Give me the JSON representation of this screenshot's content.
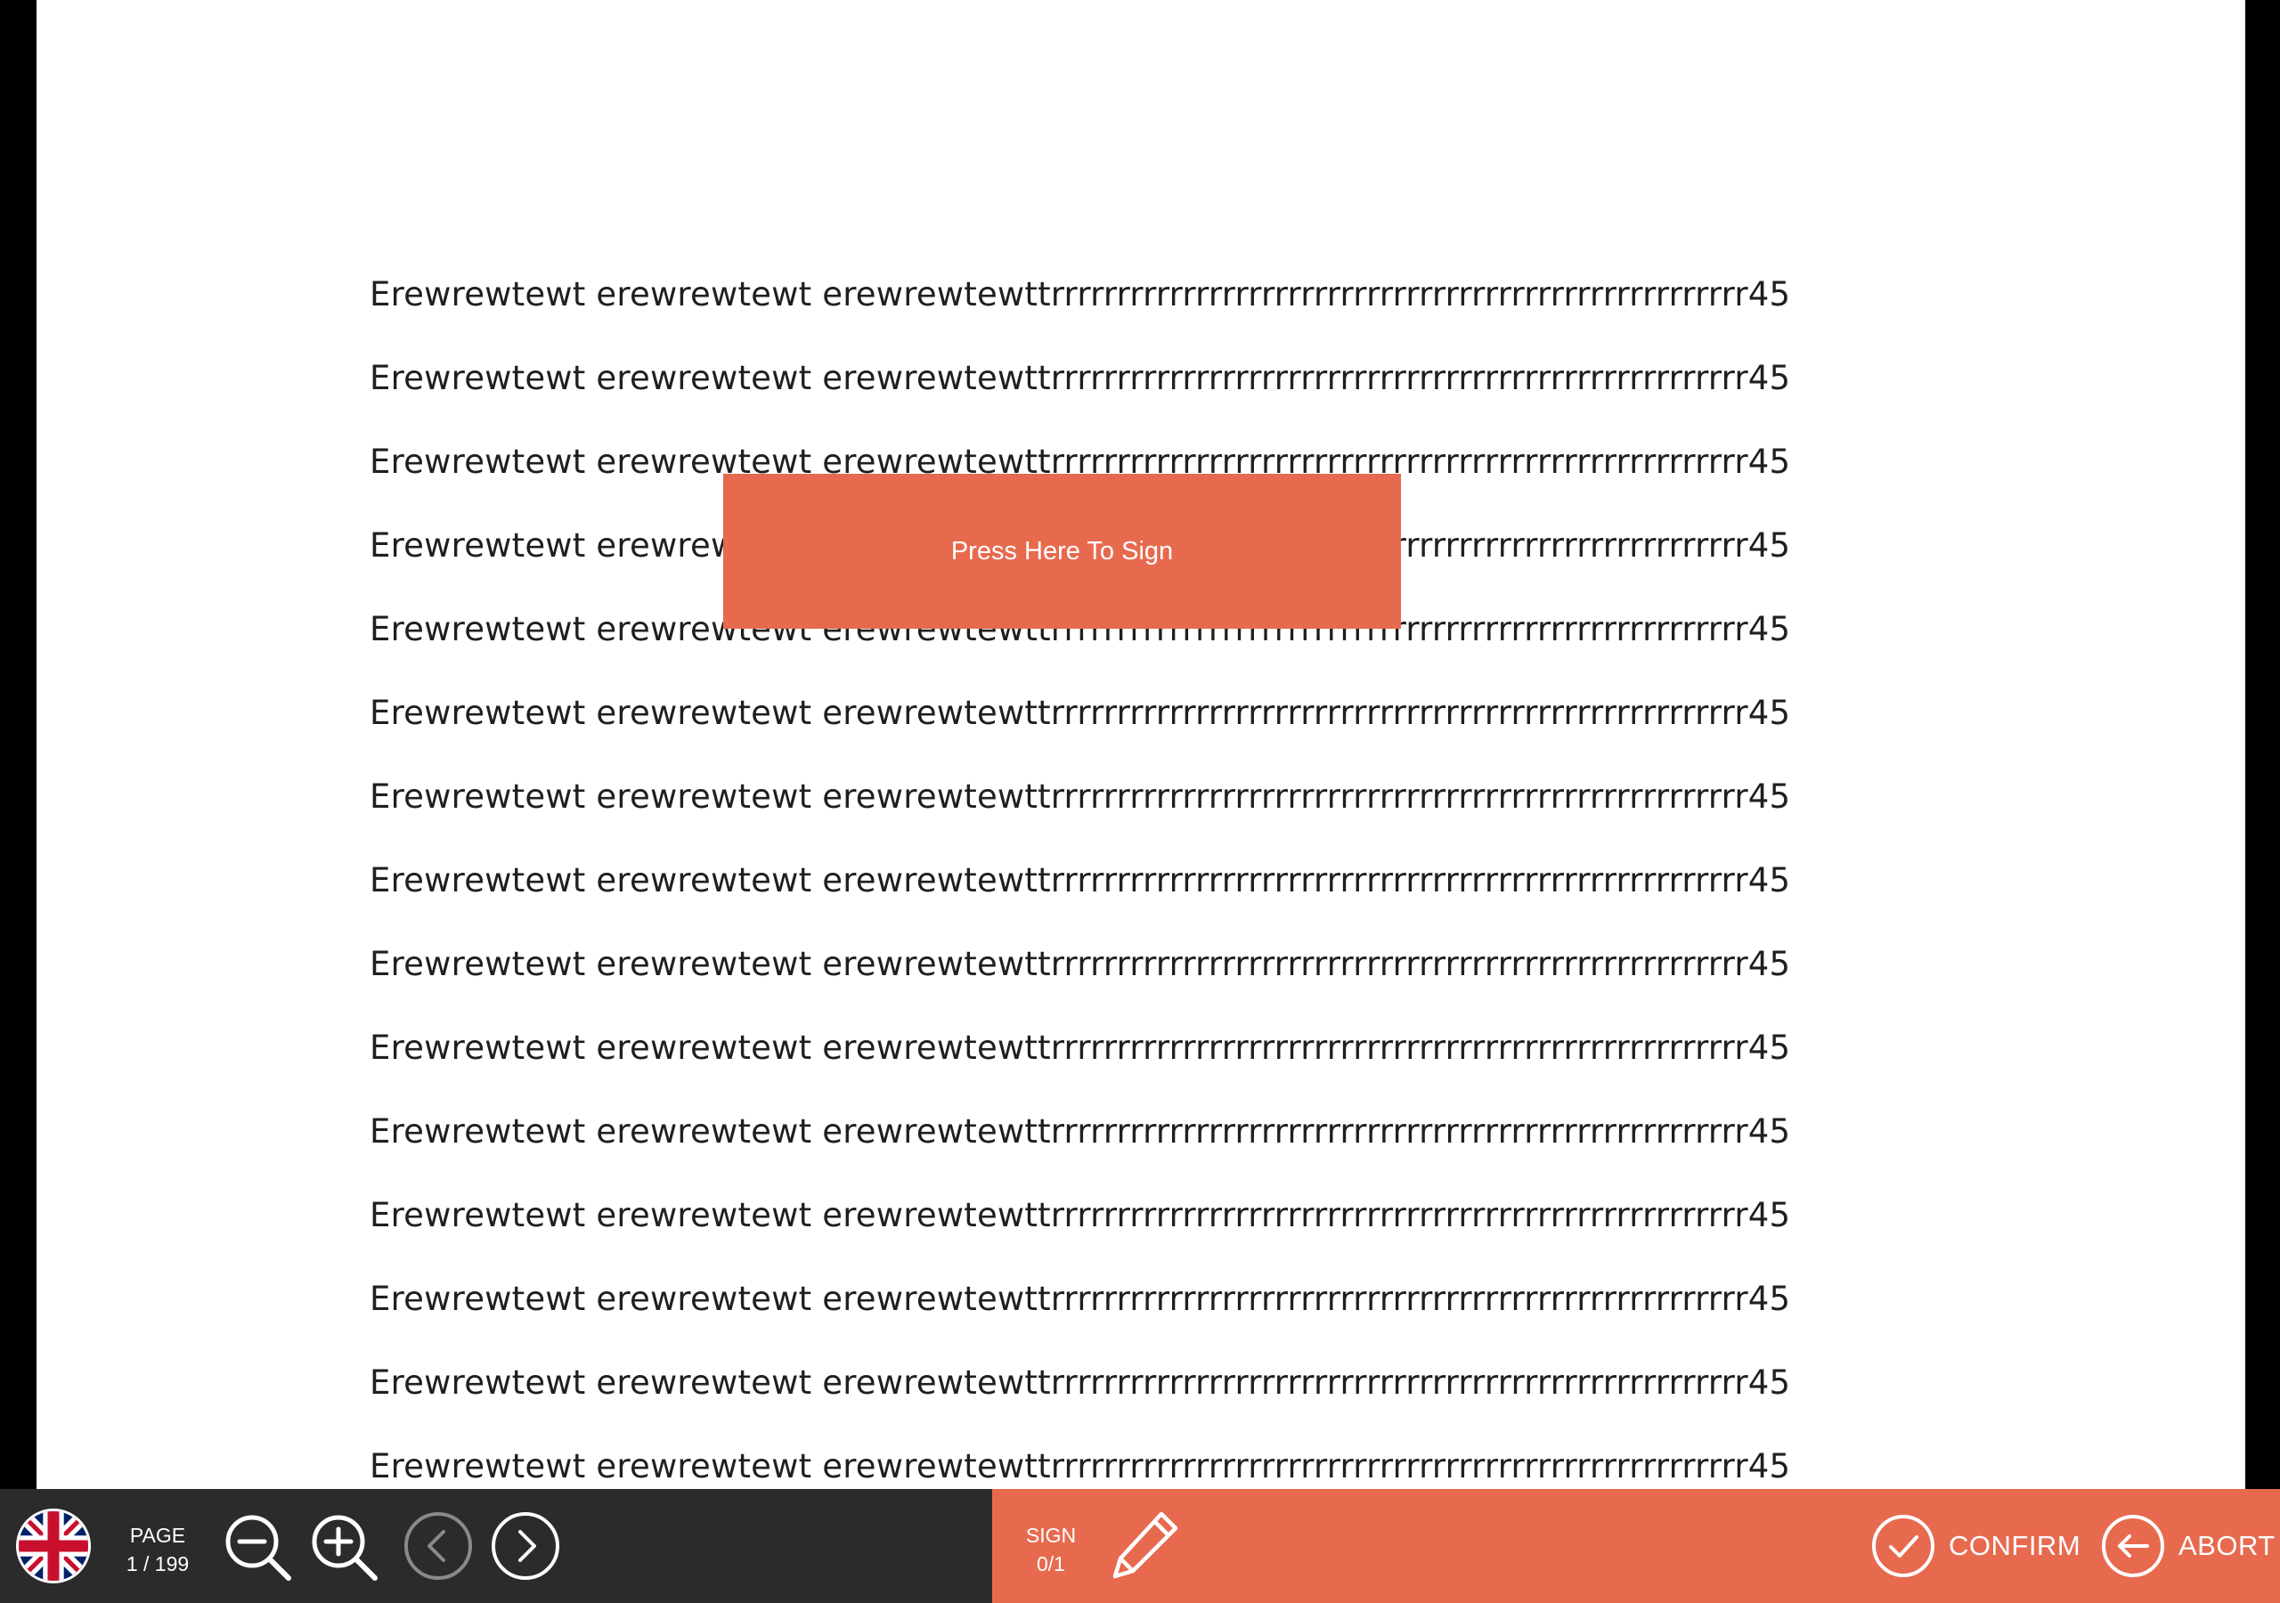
{
  "document": {
    "lines": [
      "Erewrewtewt erewrewtewt erewrewtewttrrrrrrrrrrrrrrrrrrrrrrrrrrrrrrrrrrrrrrrrrrrrrrrrrrrrr45",
      "Erewrewtewt erewrewtewt erewrewtewttrrrrrrrrrrrrrrrrrrrrrrrrrrrrrrrrrrrrrrrrrrrrrrrrrrrrr45",
      "Erewrewtewt erewrewtewt erewrewtewttrrrrrrrrrrrrrrrrrrrrrrrrrrrrrrrrrrrrrrrrrrrrrrrrrrrrr45",
      "Erewrewtewt erewrewtewt erewrewtewttrrrrrrrrrrrrrrrrrrrrrrrrrrrrrrrrrrrrrrrrrrrrrrrrrrrrr45",
      "Erewrewtewt erewrewtewt erewrewtewttrrrrrrrrrrrrrrrrrrrrrrrrrrrrrrrrrrrrrrrrrrrrrrrrrrrrr45",
      "Erewrewtewt erewrewtewt erewrewtewttrrrrrrrrrrrrrrrrrrrrrrrrrrrrrrrrrrrrrrrrrrrrrrrrrrrrr45",
      "Erewrewtewt erewrewtewt erewrewtewttrrrrrrrrrrrrrrrrrrrrrrrrrrrrrrrrrrrrrrrrrrrrrrrrrrrrr45",
      "Erewrewtewt erewrewtewt erewrewtewttrrrrrrrrrrrrrrrrrrrrrrrrrrrrrrrrrrrrrrrrrrrrrrrrrrrrr45",
      "Erewrewtewt erewrewtewt erewrewtewttrrrrrrrrrrrrrrrrrrrrrrrrrrrrrrrrrrrrrrrrrrrrrrrrrrrrr45",
      "Erewrewtewt erewrewtewt erewrewtewttrrrrrrrrrrrrrrrrrrrrrrrrrrrrrrrrrrrrrrrrrrrrrrrrrrrrr45",
      "Erewrewtewt erewrewtewt erewrewtewttrrrrrrrrrrrrrrrrrrrrrrrrrrrrrrrrrrrrrrrrrrrrrrrrrrrrr45",
      "Erewrewtewt erewrewtewt erewrewtewttrrrrrrrrrrrrrrrrrrrrrrrrrrrrrrrrrrrrrrrrrrrrrrrrrrrrr45",
      "Erewrewtewt erewrewtewt erewrewtewttrrrrrrrrrrrrrrrrrrrrrrrrrrrrrrrrrrrrrrrrrrrrrrrrrrrrr45",
      "Erewrewtewt erewrewtewt erewrewtewttrrrrrrrrrrrrrrrrrrrrrrrrrrrrrrrrrrrrrrrrrrrrrrrrrrrrr45",
      "Erewrewtewt erewrewtewt erewrewtewttrrrrrrrrrrrrrrrrrrrrrrrrrrrrrrrrrrrrrrrrrrrrrrrrrrrrr45"
    ]
  },
  "signature_field": {
    "label": "Press Here To Sign"
  },
  "toolbar": {
    "language_icon": "uk-flag-icon",
    "page_label": "PAGE",
    "page_value": "1 / 199",
    "zoom_out_icon": "zoom-out-icon",
    "zoom_in_icon": "zoom-in-icon",
    "prev_icon": "chevron-left-icon",
    "next_icon": "chevron-right-icon",
    "sign_label": "SIGN",
    "sign_value": "0/1",
    "pen_icon": "pen-icon",
    "confirm_label": "CONFIRM",
    "abort_label": "ABORT"
  },
  "colors": {
    "accent": "#e76a4f",
    "toolbar_dark": "#2b2b2b",
    "page_background": "#ffffff",
    "outer_background": "#000000"
  }
}
